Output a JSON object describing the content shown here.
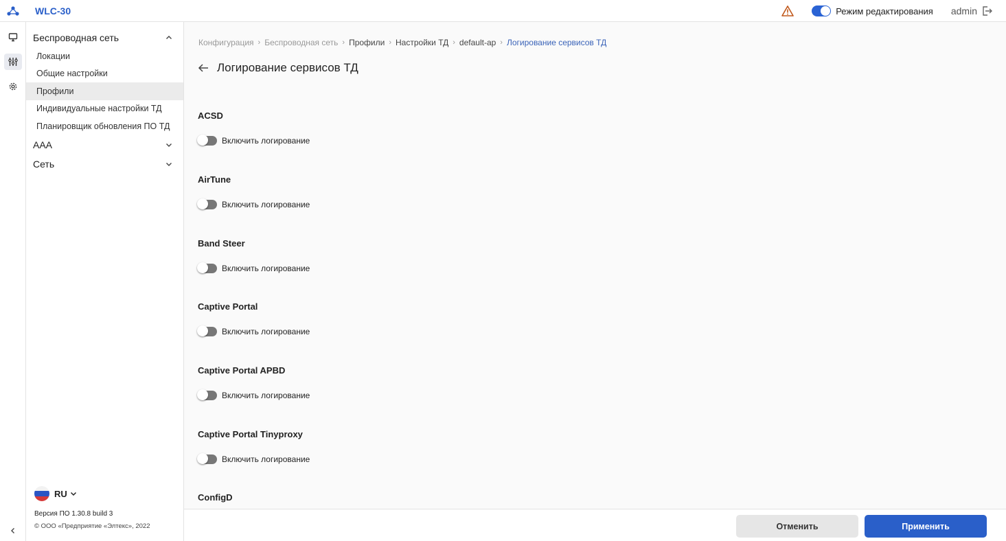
{
  "app": {
    "title": "WLC-30"
  },
  "header": {
    "edit_mode_label": "Режим редактирования",
    "user": "admin",
    "edit_mode_on": true
  },
  "sidebar": {
    "groups": [
      {
        "label": "Беспроводная сеть",
        "expanded": true,
        "items": [
          {
            "label": "Локации"
          },
          {
            "label": "Общие настройки"
          },
          {
            "label": "Профили",
            "active": true
          },
          {
            "label": "Индивидуальные настройки ТД"
          },
          {
            "label": "Планировщик обновления ПО ТД"
          }
        ]
      },
      {
        "label": "AAA",
        "expanded": false
      },
      {
        "label": "Сеть",
        "expanded": false
      }
    ],
    "language": "RU",
    "version": "Версия ПО 1.30.8 build 3",
    "copyright": "© ООО «Предприятие «Элтекс», 2022"
  },
  "breadcrumb": [
    "Конфигурация",
    "Беспроводная сеть",
    "Профили",
    "Настройки ТД",
    "default-ap",
    "Логирование сервисов ТД"
  ],
  "page": {
    "title": "Логирование сервисов ТД"
  },
  "sections": [
    {
      "title": "ACSD",
      "switch_label": "Включить логирование",
      "enabled": false
    },
    {
      "title": "AirTune",
      "switch_label": "Включить логирование",
      "enabled": false
    },
    {
      "title": "Band Steer",
      "switch_label": "Включить логирование",
      "enabled": false
    },
    {
      "title": "Captive Portal",
      "switch_label": "Включить логирование",
      "enabled": false
    },
    {
      "title": "Captive Portal APBD",
      "switch_label": "Включить логирование",
      "enabled": false
    },
    {
      "title": "Captive Portal Tinyproxy",
      "switch_label": "Включить логирование",
      "enabled": false
    },
    {
      "title": "ConfigD"
    }
  ],
  "footer": {
    "cancel_label": "Отменить",
    "apply_label": "Применить"
  },
  "colors": {
    "accent": "#2a5fc9",
    "breadcrumb_current": "#3a63b8",
    "warning": "#c0581b"
  }
}
